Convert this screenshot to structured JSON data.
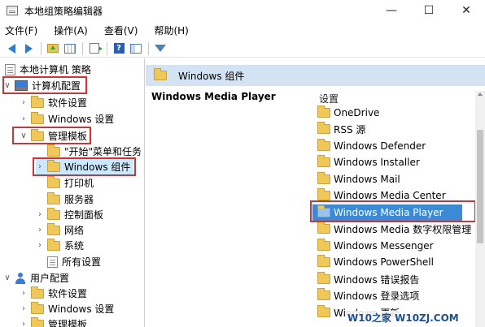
{
  "window": {
    "title": "本地组策略编辑器",
    "controls": {
      "minimize": "—",
      "maximize": "☐",
      "close": "✕"
    }
  },
  "menu": {
    "items": [
      "文件(F)",
      "操作(A)",
      "查看(V)",
      "帮助(H)"
    ]
  },
  "toolbar": {
    "icons": [
      "back-icon",
      "forward-icon",
      "up-folder-icon",
      "grid-icon",
      "export-icon",
      "help-icon",
      "panel-icon",
      "filter-icon"
    ],
    "help_glyph": "?"
  },
  "tree": {
    "root": "本地计算机 策略",
    "computer_config": "计算机配置",
    "software_settings": "软件设置",
    "windows_settings": "Windows 设置",
    "admin_templates": "管理模板",
    "start_menu": "\"开始\"菜单和任务",
    "windows_components": "Windows 组件",
    "printers": "打印机",
    "server": "服务器",
    "control_panel": "控制面板",
    "network": "网络",
    "system": "系统",
    "all_settings": "所有设置",
    "user_config": "用户配置",
    "user_software_settings": "软件设置",
    "user_windows_settings": "Windows 设置",
    "user_admin_templates": "管理模板"
  },
  "right_pane": {
    "header": "Windows 组件",
    "selected_title": "Windows Media Player",
    "settings_label": "设置",
    "items": [
      "OneDrive",
      "RSS 源",
      "Windows Defender",
      "Windows Installer",
      "Windows Mail",
      "Windows Media Center",
      "Windows Media Player",
      "Windows Media 数字权限管理",
      "Windows Messenger",
      "Windows PowerShell",
      "Windows 错误报告",
      "Windows 登录选项",
      "Windows 更新"
    ]
  },
  "colors": {
    "selection": "#3b8ad8",
    "header_bg": "#d4e3f3",
    "highlight_box": "#d83030",
    "folder": "#f0c85a"
  },
  "watermark": "W10之家 W10ZJ.COM"
}
